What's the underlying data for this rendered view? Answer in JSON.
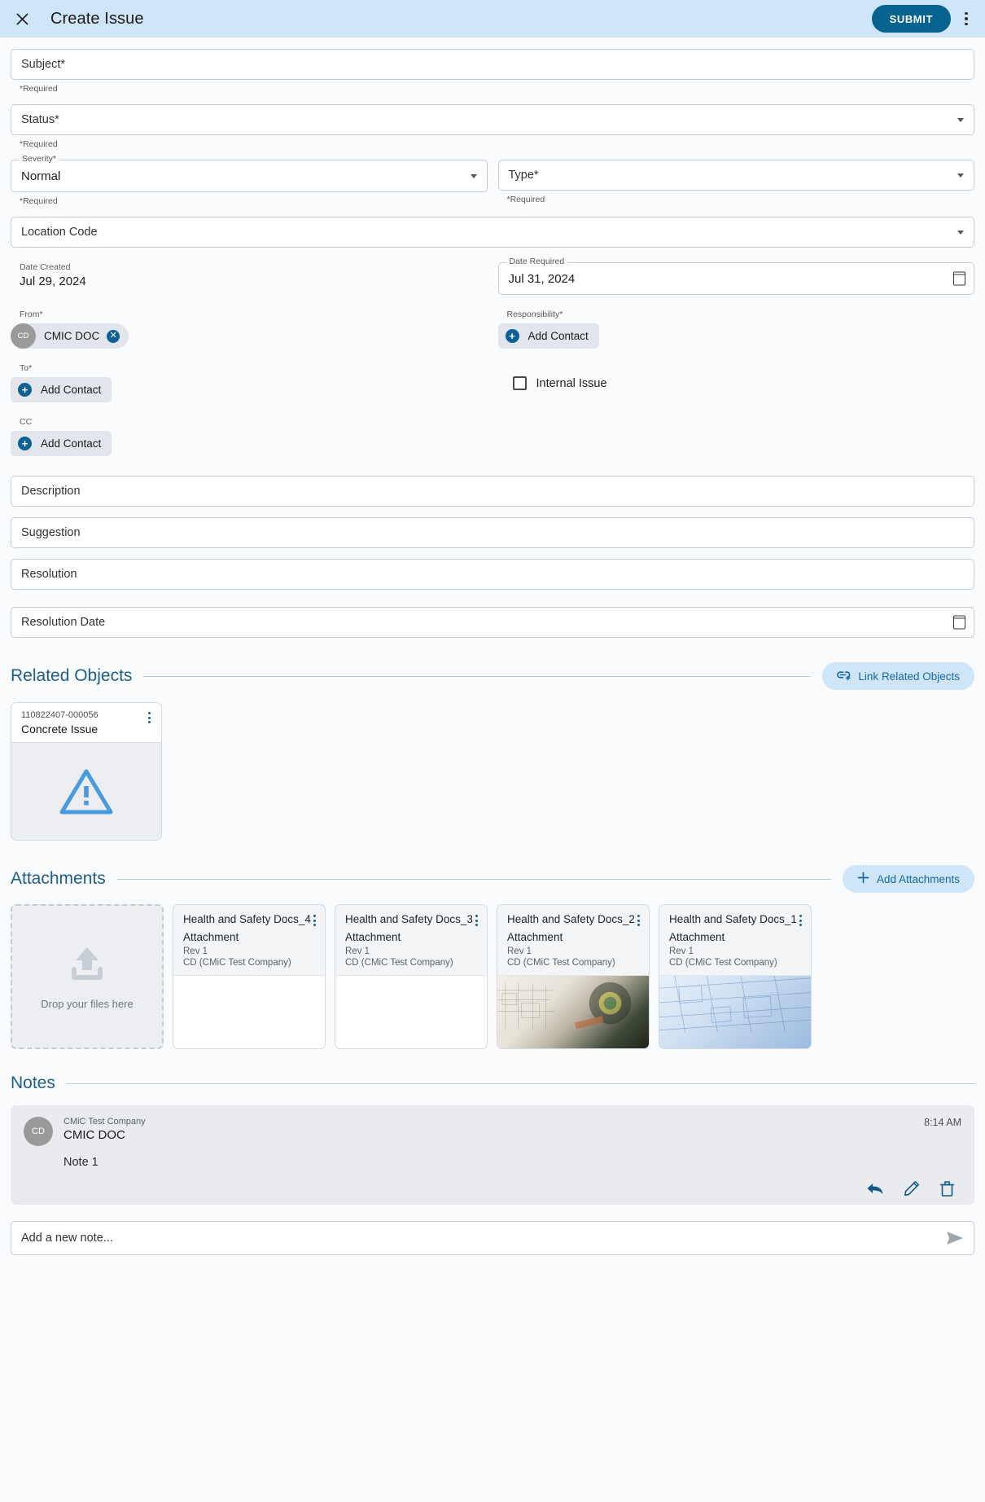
{
  "topbar": {
    "close_icon": "close-icon",
    "title": "Create Issue",
    "submit_label": "SUBMIT",
    "overflow_icon": "more-vertical-icon"
  },
  "form": {
    "subject": {
      "label": "Subject*",
      "value": "",
      "helper": "*Required"
    },
    "status": {
      "label": "Status*",
      "value": "",
      "helper": "*Required"
    },
    "severity": {
      "label": "Severity*",
      "value": "Normal",
      "helper": "*Required"
    },
    "type": {
      "label": "Type*",
      "value": "",
      "helper": "*Required"
    },
    "location_code": {
      "label": "Location Code",
      "value": ""
    },
    "date_created": {
      "label": "Date Created",
      "value": "Jul 29, 2024"
    },
    "date_required": {
      "label": "Date Required",
      "value": "Jul 31, 2024"
    },
    "from": {
      "label": "From*",
      "chip": {
        "initials": "CD",
        "name": "CMIC DOC",
        "remove_icon": "close-circle-icon"
      }
    },
    "responsibility": {
      "label": "Responsibility*",
      "add_label": "Add Contact"
    },
    "to": {
      "label": "To*",
      "add_label": "Add Contact"
    },
    "cc": {
      "label": "CC",
      "add_label": "Add Contact"
    },
    "internal_issue": {
      "label": "Internal Issue",
      "checked": false
    },
    "description": {
      "label": "Description",
      "value": ""
    },
    "suggestion": {
      "label": "Suggestion",
      "value": ""
    },
    "resolution": {
      "label": "Resolution",
      "value": ""
    },
    "resolution_date": {
      "label": "Resolution Date",
      "value": ""
    }
  },
  "related_objects": {
    "title": "Related Objects",
    "link_button": "Link Related Objects",
    "cards": [
      {
        "id": "110822407-000056",
        "name": "Concrete Issue",
        "thumb": "warning-triangle"
      }
    ]
  },
  "attachments": {
    "title": "Attachments",
    "add_button": "Add Attachments",
    "dropzone": "Drop your files here",
    "cards": [
      {
        "title": "Health and Safety Docs_4",
        "type": "Attachment",
        "rev": "Rev 1",
        "owner": "CD (CMiC Test Company)",
        "thumb": "blank"
      },
      {
        "title": "Health and Safety Docs_3",
        "type": "Attachment",
        "rev": "Rev 1",
        "owner": "CD (CMiC Test Company)",
        "thumb": "blank"
      },
      {
        "title": "Health and Safety Docs_2",
        "type": "Attachment",
        "rev": "Rev 1",
        "owner": "CD (CMiC Test Company)",
        "thumb": "draw1"
      },
      {
        "title": "Health and Safety Docs_1",
        "type": "Attachment",
        "rev": "Rev 1",
        "owner": "CD (CMiC Test Company)",
        "thumb": "draw2"
      }
    ]
  },
  "notes": {
    "title": "Notes",
    "items": [
      {
        "initials": "CD",
        "company": "CMiC Test Company",
        "author": "CMIC DOC",
        "time": "8:14 AM",
        "body": "Note 1",
        "actions": [
          "reply-icon",
          "edit-icon",
          "delete-icon"
        ]
      }
    ],
    "new_note_placeholder": "Add a new note...",
    "send_icon": "send-icon"
  },
  "colors": {
    "header_bg": "#cfe5f8",
    "accent": "#06628f",
    "section_title": "#1d5e8c",
    "pill_bg": "#cfe5f8"
  }
}
